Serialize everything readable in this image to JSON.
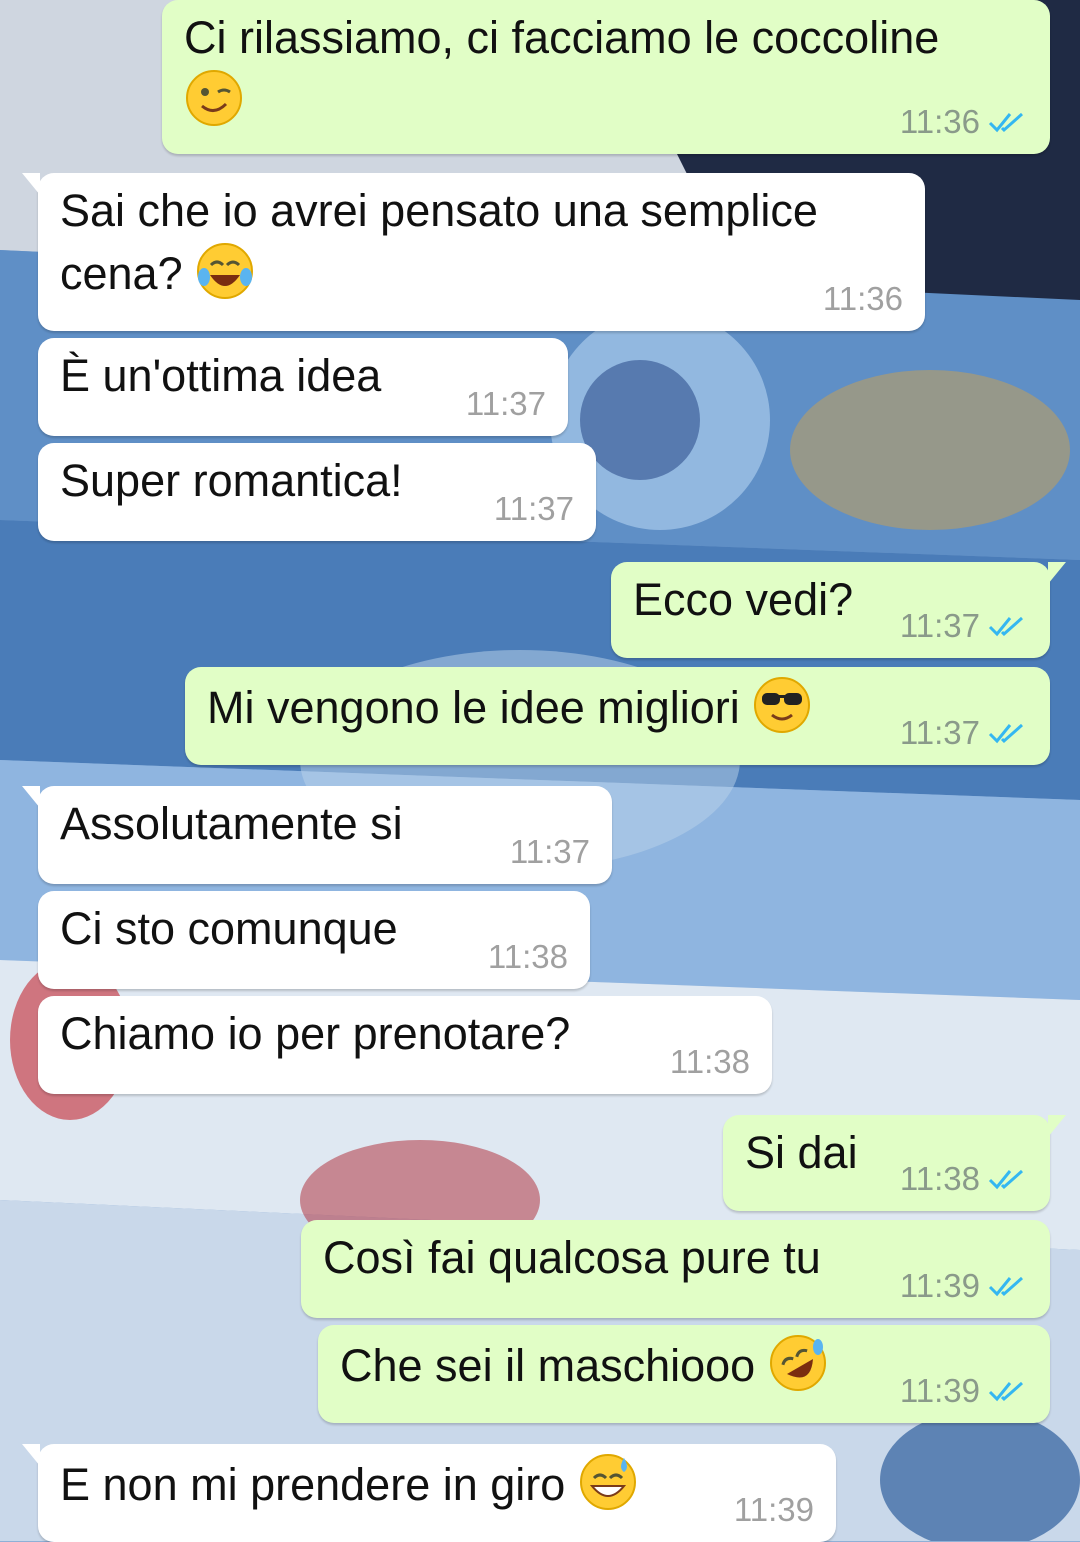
{
  "colors": {
    "outgoing_bubble": "#e1fec6",
    "incoming_bubble": "#ffffff",
    "read_ticks": "#34b7f1",
    "timestamp": "#8a9a8a"
  },
  "messages": [
    {
      "direction": "out",
      "text": "Ci rilassiamo, ci facciamo le coccoline",
      "emoji": "winking-face",
      "time": "11:36",
      "status": "read"
    },
    {
      "direction": "in",
      "text": "Sai che io avrei pensato una semplice\ncena?",
      "emoji": "face-with-tears-of-joy",
      "time": "11:36"
    },
    {
      "direction": "in",
      "text": "È un'ottima idea",
      "time": "11:37"
    },
    {
      "direction": "in",
      "text": "Super romantica!",
      "time": "11:37"
    },
    {
      "direction": "out",
      "text": "Ecco vedi?",
      "time": "11:37",
      "status": "read"
    },
    {
      "direction": "out",
      "text": "Mi vengono le idee migliori",
      "emoji": "sunglasses-face",
      "time": "11:37",
      "status": "read"
    },
    {
      "direction": "in",
      "text": "Assolutamente si",
      "time": "11:37"
    },
    {
      "direction": "in",
      "text": "Ci sto comunque",
      "time": "11:38"
    },
    {
      "direction": "in",
      "text": "Chiamo io per prenotare?",
      "time": "11:38"
    },
    {
      "direction": "out",
      "text": "Si dai",
      "time": "11:38",
      "status": "read"
    },
    {
      "direction": "out",
      "text": "Così fai qualcosa pure tu",
      "time": "11:39",
      "status": "read"
    },
    {
      "direction": "out",
      "text": "Che sei il maschiooo",
      "emoji": "rolling-on-floor-laughing",
      "time": "11:39",
      "status": "read"
    },
    {
      "direction": "in",
      "text": "E non mi prendere in giro",
      "emoji": "grinning-sweat-face",
      "time": "11:39"
    }
  ]
}
